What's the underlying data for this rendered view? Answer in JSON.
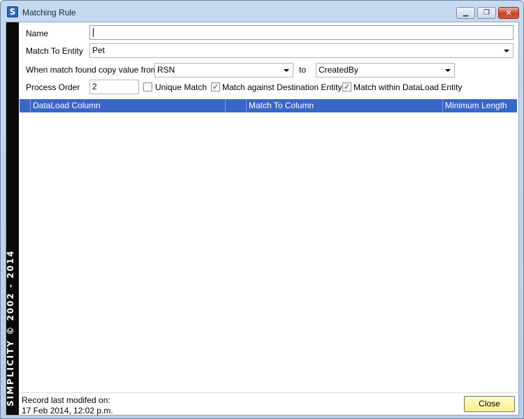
{
  "window": {
    "title": "Matching Rule",
    "app_icon_glyph": "S",
    "minimize_glyph": "▁",
    "maximize_glyph": "❐",
    "close_glyph": "✕"
  },
  "brand": {
    "text": "SIMPLICITY © 2002 - 2014"
  },
  "form": {
    "name_label": "Name",
    "name_value": "",
    "match_to_entity_label": "Match To Entity",
    "match_to_entity_value": "Pet",
    "copy_value_label": "When match found copy value from",
    "copy_from_value": "RSN",
    "to_label": "to",
    "copy_to_value": "CreatedBy",
    "process_order_label": "Process Order",
    "process_order_value": "2",
    "unique_match": {
      "label": "Unique Match",
      "checked": false
    },
    "match_against_destination": {
      "label": "Match against Destination Entity",
      "checked": true
    },
    "match_within_dataload": {
      "label": "Match within DataLoad Entity",
      "checked": true
    }
  },
  "grid": {
    "columns": [
      "DataLoad Column",
      "",
      "Match To Column",
      "Minimum Length"
    ],
    "rows": []
  },
  "footer": {
    "record_label": "Record last modifed on:",
    "record_timestamp": "17 Feb 2014, 12:02 p.m.",
    "close_label": "Close"
  },
  "colors": {
    "grid_header": "#3966c7",
    "close_button": "#fdf08a",
    "brand_strip": "#0a0a0a"
  }
}
